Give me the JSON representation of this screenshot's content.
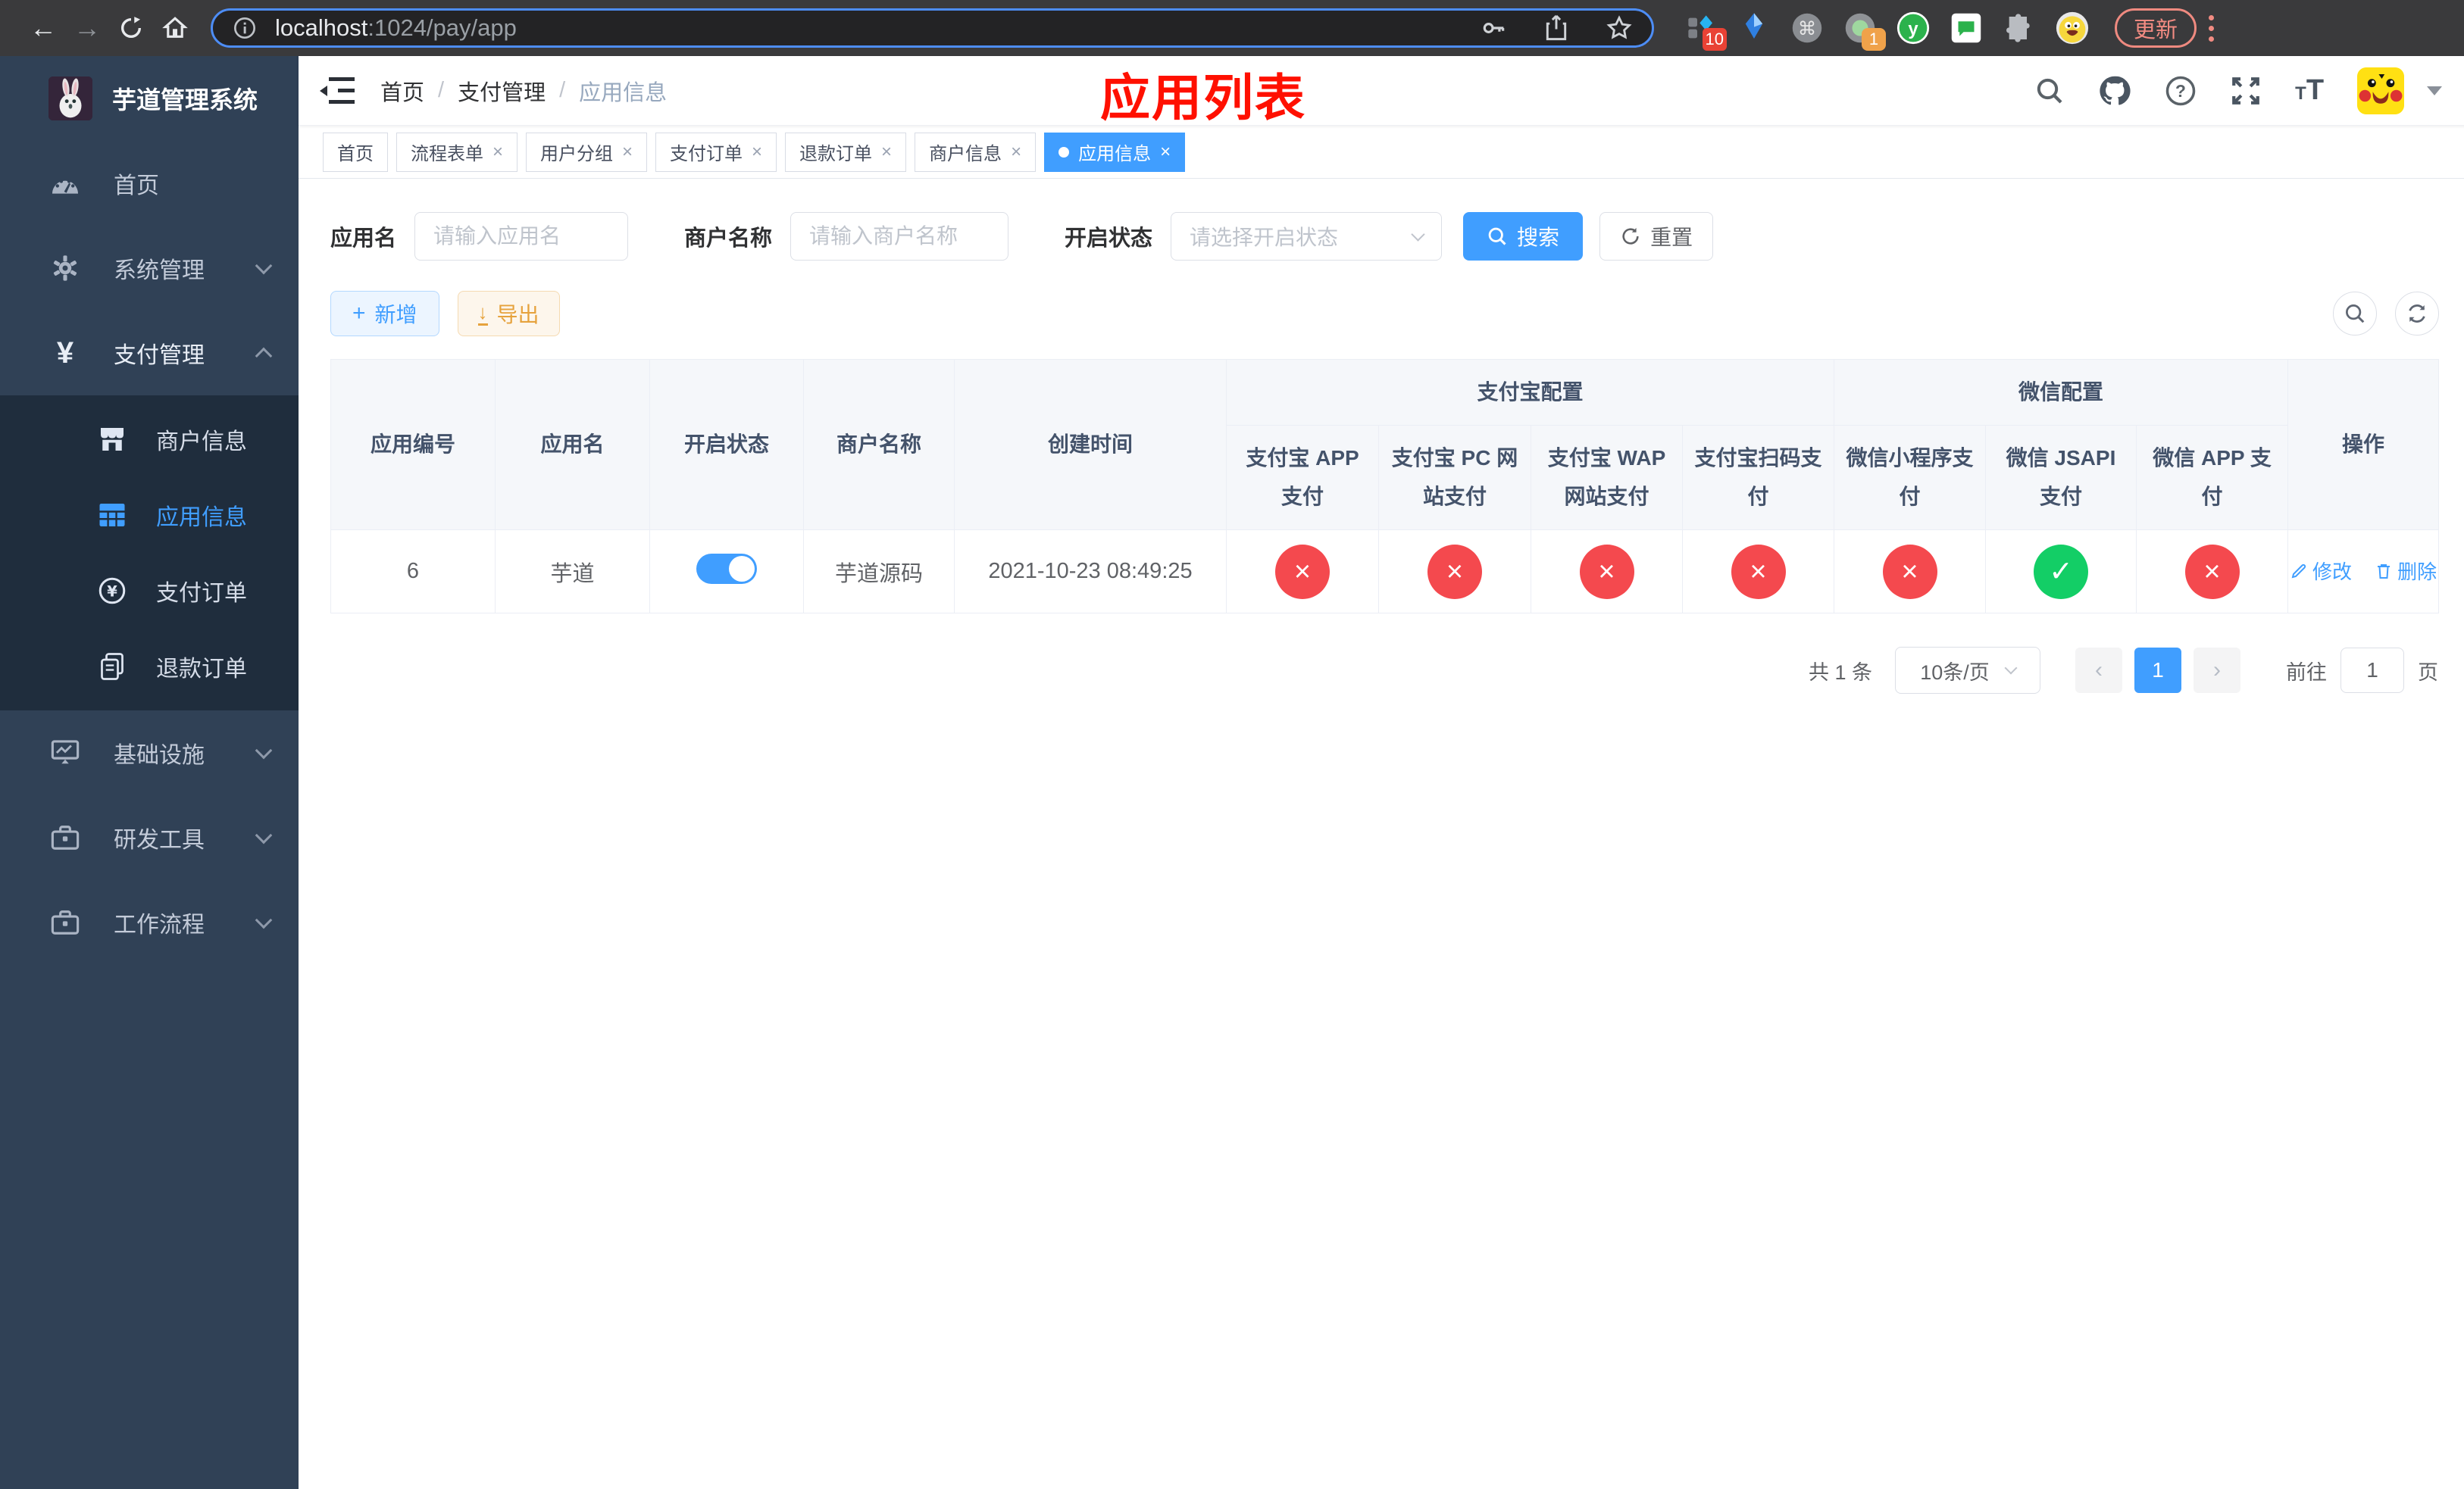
{
  "browser": {
    "url_host": "localhost",
    "url_path": ":1024/pay/app",
    "ext_badge_blue": "10",
    "ext_badge_circle": "1",
    "update_label": "更新"
  },
  "sidebar": {
    "title": "芋道管理系统",
    "items": [
      {
        "label": "首页",
        "icon": "dashboard-icon"
      },
      {
        "label": "系统管理",
        "icon": "gear-icon"
      },
      {
        "label": "支付管理",
        "icon": "yen-icon"
      },
      {
        "label": "基础设施",
        "icon": "monitor-icon"
      },
      {
        "label": "研发工具",
        "icon": "toolbox-icon"
      },
      {
        "label": "工作流程",
        "icon": "briefcase-icon"
      }
    ],
    "submenu": [
      {
        "label": "商户信息",
        "icon": "storefront-icon"
      },
      {
        "label": "应用信息",
        "icon": "grid-icon",
        "active": true
      },
      {
        "label": "支付订单",
        "icon": "pay-order-icon"
      },
      {
        "label": "退款订单",
        "icon": "refund-icon"
      }
    ]
  },
  "header": {
    "breadcrumb": [
      "首页",
      "支付管理",
      "应用信息"
    ],
    "annotation": "应用列表"
  },
  "tabs": [
    {
      "label": "首页"
    },
    {
      "label": "流程表单"
    },
    {
      "label": "用户分组"
    },
    {
      "label": "支付订单"
    },
    {
      "label": "退款订单"
    },
    {
      "label": "商户信息"
    },
    {
      "label": "应用信息",
      "active": true
    }
  ],
  "filters": {
    "app_name_label": "应用名",
    "app_name_placeholder": "请输入应用名",
    "merchant_label": "商户名称",
    "merchant_placeholder": "请输入商户名称",
    "status_label": "开启状态",
    "status_placeholder": "请选择开启状态",
    "search_label": "搜索",
    "reset_label": "重置"
  },
  "toolbar": {
    "add_label": "新增",
    "export_label": "导出"
  },
  "table": {
    "headers": {
      "app_id": "应用编号",
      "app_name": "应用名",
      "status": "开启状态",
      "merchant": "商户名称",
      "created": "创建时间",
      "alipay_group": "支付宝配置",
      "wechat_group": "微信配置",
      "actions": "操作"
    },
    "sub_headers": [
      "支付宝 APP 支付",
      "支付宝 PC 网站支付",
      "支付宝 WAP 网站支付",
      "支付宝扫码支付",
      "微信小程序支付",
      "微信 JSAPI 支付",
      "微信 APP 支付"
    ],
    "row": {
      "id": "6",
      "name": "芋道",
      "enabled": true,
      "merchant": "芋道源码",
      "created_at": "2021-10-23 08:49:25",
      "statuses": [
        "fail",
        "fail",
        "fail",
        "fail",
        "fail",
        "ok",
        "fail"
      ]
    },
    "row_actions": {
      "edit": "修改",
      "delete": "删除"
    }
  },
  "pagination": {
    "total": "共 1 条",
    "page_size": "10条/页",
    "current_page": "1",
    "goto_prefix": "前往",
    "goto_value": "1",
    "goto_suffix": "页"
  },
  "colors": {
    "primary": "#409eff",
    "danger": "#f4494e",
    "success": "#13ce66",
    "warning": "#e6a23c",
    "annotation_red": "#ff1000",
    "sidebar_bg": "#304156",
    "submenu_bg": "#1f2d3d"
  }
}
